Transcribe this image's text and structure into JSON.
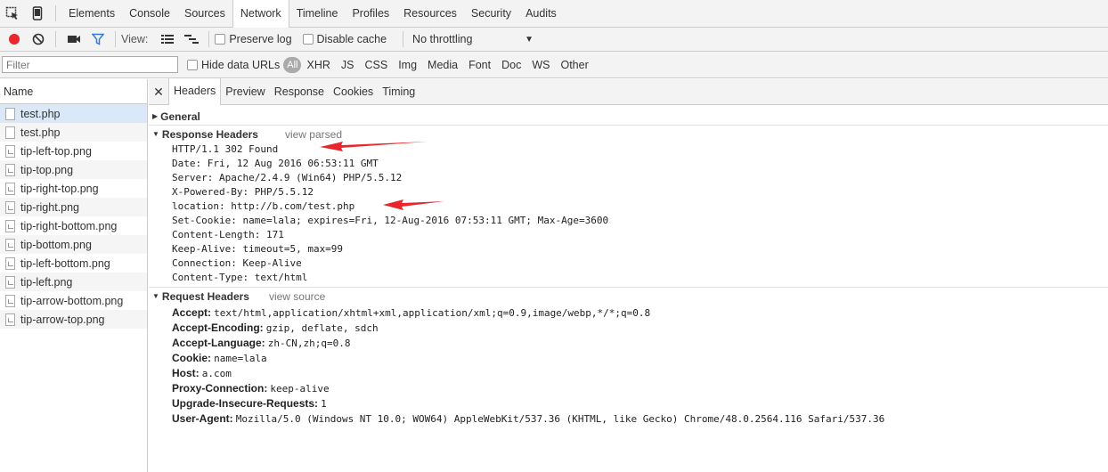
{
  "tabs": [
    {
      "label": "Elements"
    },
    {
      "label": "Console"
    },
    {
      "label": "Sources"
    },
    {
      "label": "Network"
    },
    {
      "label": "Timeline"
    },
    {
      "label": "Profiles"
    },
    {
      "label": "Resources"
    },
    {
      "label": "Security"
    },
    {
      "label": "Audits"
    }
  ],
  "active_tab": "Network",
  "toolbar": {
    "view_label": "View:",
    "preserve_log": "Preserve log",
    "disable_cache": "Disable cache",
    "throttling": "No throttling",
    "record_color": "#e8262b",
    "filter_color": "#3b7bd4"
  },
  "filterbar": {
    "filter_placeholder": "Filter",
    "hide_data_urls": "Hide data URLs",
    "types": [
      "All",
      "XHR",
      "JS",
      "CSS",
      "Img",
      "Media",
      "Font",
      "Doc",
      "WS",
      "Other"
    ]
  },
  "name_header": "Name",
  "files": [
    {
      "name": "test.php",
      "icon": "document-icon"
    },
    {
      "name": "test.php",
      "icon": "document-icon"
    },
    {
      "name": "tip-left-top.png",
      "icon": "image-icon"
    },
    {
      "name": "tip-top.png",
      "icon": "image-icon"
    },
    {
      "name": "tip-right-top.png",
      "icon": "image-icon"
    },
    {
      "name": "tip-right.png",
      "icon": "image-icon"
    },
    {
      "name": "tip-right-bottom.png",
      "icon": "image-icon"
    },
    {
      "name": "tip-bottom.png",
      "icon": "image-icon"
    },
    {
      "name": "tip-left-bottom.png",
      "icon": "image-icon"
    },
    {
      "name": "tip-left.png",
      "icon": "image-icon"
    },
    {
      "name": "tip-arrow-bottom.png",
      "icon": "image-icon"
    },
    {
      "name": "tip-arrow-top.png",
      "icon": "image-icon"
    }
  ],
  "detail_tabs": [
    "Headers",
    "Preview",
    "Response",
    "Cookies",
    "Timing"
  ],
  "general": {
    "title": "General"
  },
  "response_headers": {
    "title": "Response Headers",
    "link": "view parsed",
    "lines": [
      "HTTP/1.1 302 Found",
      "Date: Fri, 12 Aug 2016 06:53:11 GMT",
      "Server: Apache/2.4.9 (Win64) PHP/5.5.12",
      "X-Powered-By: PHP/5.5.12",
      "location: http://b.com/test.php",
      "Set-Cookie: name=lala; expires=Fri, 12-Aug-2016 07:53:11 GMT; Max-Age=3600",
      "Content-Length: 171",
      "Keep-Alive: timeout=5, max=99",
      "Connection: Keep-Alive",
      "Content-Type: text/html"
    ]
  },
  "request_headers": {
    "title": "Request Headers",
    "link": "view source",
    "items": [
      {
        "name": "Accept:",
        "value": "text/html,application/xhtml+xml,application/xml;q=0.9,image/webp,*/*;q=0.8"
      },
      {
        "name": "Accept-Encoding:",
        "value": "gzip, deflate, sdch"
      },
      {
        "name": "Accept-Language:",
        "value": "zh-CN,zh;q=0.8"
      },
      {
        "name": "Cookie:",
        "value": "name=lala"
      },
      {
        "name": "Host:",
        "value": "a.com"
      },
      {
        "name": "Proxy-Connection:",
        "value": "keep-alive"
      },
      {
        "name": "Upgrade-Insecure-Requests:",
        "value": "1"
      },
      {
        "name": "User-Agent:",
        "value": "Mozilla/5.0 (Windows NT 10.0; WOW64) AppleWebKit/537.36 (KHTML, like Gecko) Chrome/48.0.2564.116 Safari/537.36"
      }
    ]
  },
  "annotation_color": "#e8262b"
}
